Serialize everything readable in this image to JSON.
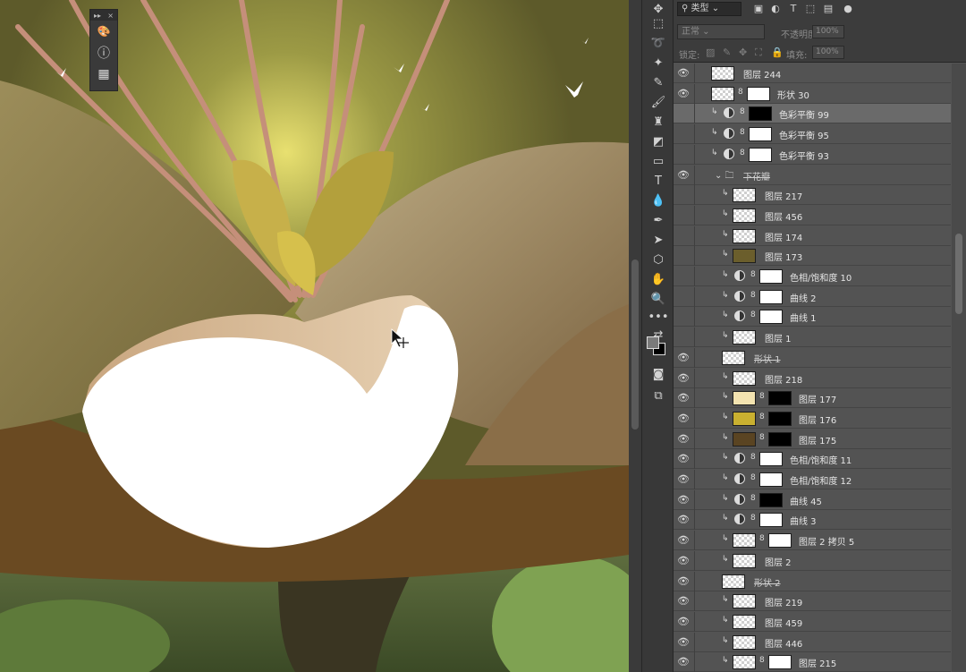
{
  "floating_panel": {
    "header_left": "▸▸",
    "close": "×",
    "buttons": [
      {
        "name": "palette-icon",
        "glyph": "🎨"
      },
      {
        "name": "info-icon",
        "glyph": "ⓘ"
      },
      {
        "name": "grid-icon",
        "glyph": "▦"
      }
    ]
  },
  "toolbar": {
    "tools": [
      {
        "name": "move-tool-icon",
        "glyph": "✥"
      },
      {
        "name": "marquee-tool-icon",
        "glyph": "⬚"
      },
      {
        "name": "lasso-tool-icon",
        "glyph": "➰"
      },
      {
        "name": "magic-wand-tool-icon",
        "glyph": "✦"
      },
      {
        "name": "eyedropper-tool-icon",
        "glyph": "✎"
      },
      {
        "name": "brush-tool-icon",
        "glyph": "🖌"
      },
      {
        "name": "stamp-tool-icon",
        "glyph": "♜"
      },
      {
        "name": "eraser-tool-icon",
        "glyph": "◩"
      },
      {
        "name": "gradient-tool-icon",
        "glyph": "▭"
      },
      {
        "name": "type-tool-icon",
        "glyph": "T"
      },
      {
        "name": "blur-tool-icon",
        "glyph": "💧"
      },
      {
        "name": "pen-tool-icon",
        "glyph": "✒"
      },
      {
        "name": "path-select-tool-icon",
        "glyph": "➤"
      },
      {
        "name": "shape-tool-icon",
        "glyph": "⬡"
      },
      {
        "name": "hand-tool-icon",
        "glyph": "✋"
      },
      {
        "name": "zoom-tool-icon",
        "glyph": "🔍"
      },
      {
        "name": "more-tools-icon",
        "glyph": "•••"
      },
      {
        "name": "swap-colors-icon",
        "glyph": "⇄"
      },
      {
        "name": "quick-mask-icon",
        "glyph": "◙"
      },
      {
        "name": "screen-mode-icon",
        "glyph": "⧉"
      }
    ]
  },
  "layers_panel": {
    "filter_label": "类型",
    "filter_icons": [
      "▣",
      "◐",
      "T",
      "⬚",
      "▤",
      "●"
    ],
    "blend_mode": "正常",
    "opacity_label": "不透明度:",
    "opacity_value": "100%",
    "lock_label": "锁定:",
    "lock_icons": [
      "▨",
      "✎",
      "✥",
      "⛶",
      "🔒"
    ],
    "fill_label": "填充:",
    "fill_value": "100%",
    "layers": [
      {
        "visible": true,
        "indent": 0,
        "clip": false,
        "kind": "pixel",
        "thumb": "check",
        "mask": null,
        "name": "图层 244",
        "selected": false
      },
      {
        "visible": true,
        "indent": 0,
        "clip": false,
        "kind": "shape",
        "thumb": "check",
        "mask": "white",
        "name": "形状 30",
        "selected": false
      },
      {
        "visible": false,
        "indent": 1,
        "clip": true,
        "kind": "adjust",
        "thumb": null,
        "mask": "black",
        "name": "色彩平衡 99",
        "selected": true
      },
      {
        "visible": false,
        "indent": 1,
        "clip": true,
        "kind": "adjust",
        "thumb": null,
        "mask": "white",
        "name": "色彩平衡 95",
        "selected": false
      },
      {
        "visible": false,
        "indent": 1,
        "clip": true,
        "kind": "adjust",
        "thumb": null,
        "mask": "white",
        "name": "色彩平衡 93",
        "selected": false
      },
      {
        "visible": true,
        "indent": 1,
        "clip": false,
        "kind": "group",
        "thumb": null,
        "mask": null,
        "name": "下花瓣",
        "selected": false
      },
      {
        "visible": false,
        "indent": 2,
        "clip": true,
        "kind": "pixel",
        "thumb": "check",
        "mask": null,
        "name": "图层 217",
        "selected": false
      },
      {
        "visible": false,
        "indent": 2,
        "clip": true,
        "kind": "pixel",
        "thumb": "check",
        "mask": null,
        "name": "图层 456",
        "selected": false
      },
      {
        "visible": false,
        "indent": 2,
        "clip": true,
        "kind": "pixel",
        "thumb": "check",
        "mask": null,
        "name": "图层 174",
        "selected": false
      },
      {
        "visible": false,
        "indent": 2,
        "clip": true,
        "kind": "pixel",
        "thumb": "olive",
        "mask": null,
        "name": "图层 173",
        "selected": false
      },
      {
        "visible": false,
        "indent": 2,
        "clip": true,
        "kind": "adjust",
        "thumb": null,
        "mask": "white",
        "name": "色相/饱和度 10",
        "selected": false
      },
      {
        "visible": false,
        "indent": 2,
        "clip": true,
        "kind": "adjust",
        "thumb": null,
        "mask": "white",
        "name": "曲线 2",
        "selected": false
      },
      {
        "visible": false,
        "indent": 2,
        "clip": true,
        "kind": "adjust",
        "thumb": null,
        "mask": "white",
        "name": "曲线 1",
        "selected": false
      },
      {
        "visible": false,
        "indent": 2,
        "clip": true,
        "kind": "pixel",
        "thumb": "check",
        "mask": null,
        "name": "图层 1",
        "selected": false
      },
      {
        "visible": true,
        "indent": 1,
        "clip": false,
        "kind": "shape",
        "thumb": "check",
        "mask": null,
        "name": "形状 1",
        "selected": false
      },
      {
        "visible": true,
        "indent": 2,
        "clip": true,
        "kind": "pixel",
        "thumb": "check",
        "mask": null,
        "name": "图层 218",
        "selected": false
      },
      {
        "visible": true,
        "indent": 2,
        "clip": true,
        "kind": "pixel",
        "thumb": "cream",
        "mask": "black",
        "name": "图层 177",
        "selected": false
      },
      {
        "visible": true,
        "indent": 2,
        "clip": true,
        "kind": "pixel",
        "thumb": "gold",
        "mask": "black",
        "name": "图层 176",
        "selected": false
      },
      {
        "visible": true,
        "indent": 2,
        "clip": true,
        "kind": "pixel",
        "thumb": "brown",
        "mask": "black",
        "name": "图层 175",
        "selected": false
      },
      {
        "visible": true,
        "indent": 2,
        "clip": true,
        "kind": "adjust",
        "thumb": null,
        "mask": "white",
        "name": "色相/饱和度 11",
        "selected": false
      },
      {
        "visible": true,
        "indent": 2,
        "clip": true,
        "kind": "adjust",
        "thumb": null,
        "mask": "white",
        "name": "色相/饱和度 12",
        "selected": false
      },
      {
        "visible": true,
        "indent": 2,
        "clip": true,
        "kind": "adjust",
        "thumb": null,
        "mask": "black",
        "name": "曲线 45",
        "selected": false
      },
      {
        "visible": true,
        "indent": 2,
        "clip": true,
        "kind": "adjust",
        "thumb": null,
        "mask": "white",
        "name": "曲线 3",
        "selected": false
      },
      {
        "visible": true,
        "indent": 2,
        "clip": true,
        "kind": "pixel",
        "thumb": "check",
        "mask": "white",
        "name": "图层 2 拷贝 5",
        "selected": false
      },
      {
        "visible": true,
        "indent": 2,
        "clip": true,
        "kind": "pixel",
        "thumb": "check",
        "mask": null,
        "name": "图层 2",
        "selected": false
      },
      {
        "visible": true,
        "indent": 1,
        "clip": false,
        "kind": "shape",
        "thumb": "check",
        "mask": null,
        "name": "形状 2",
        "selected": false
      },
      {
        "visible": true,
        "indent": 2,
        "clip": true,
        "kind": "pixel",
        "thumb": "check",
        "mask": null,
        "name": "图层 219",
        "selected": false
      },
      {
        "visible": true,
        "indent": 2,
        "clip": true,
        "kind": "pixel",
        "thumb": "check",
        "mask": null,
        "name": "图层 459",
        "selected": false
      },
      {
        "visible": true,
        "indent": 2,
        "clip": true,
        "kind": "pixel",
        "thumb": "check",
        "mask": null,
        "name": "图层 446",
        "selected": false
      },
      {
        "visible": true,
        "indent": 2,
        "clip": true,
        "kind": "pixel",
        "thumb": "check",
        "mask": "white",
        "name": "图层 215",
        "selected": false
      }
    ]
  },
  "colors": {
    "canvas_bg": "#8a7b45",
    "panel_bg": "#535353",
    "selected_row": "#6a6a6a",
    "toolbar_bg": "#383838",
    "thumb_olive": "#6b5e2c",
    "thumb_cream": "#f3e3b0",
    "thumb_gold": "#c9b030",
    "thumb_brown": "#5a4422"
  }
}
